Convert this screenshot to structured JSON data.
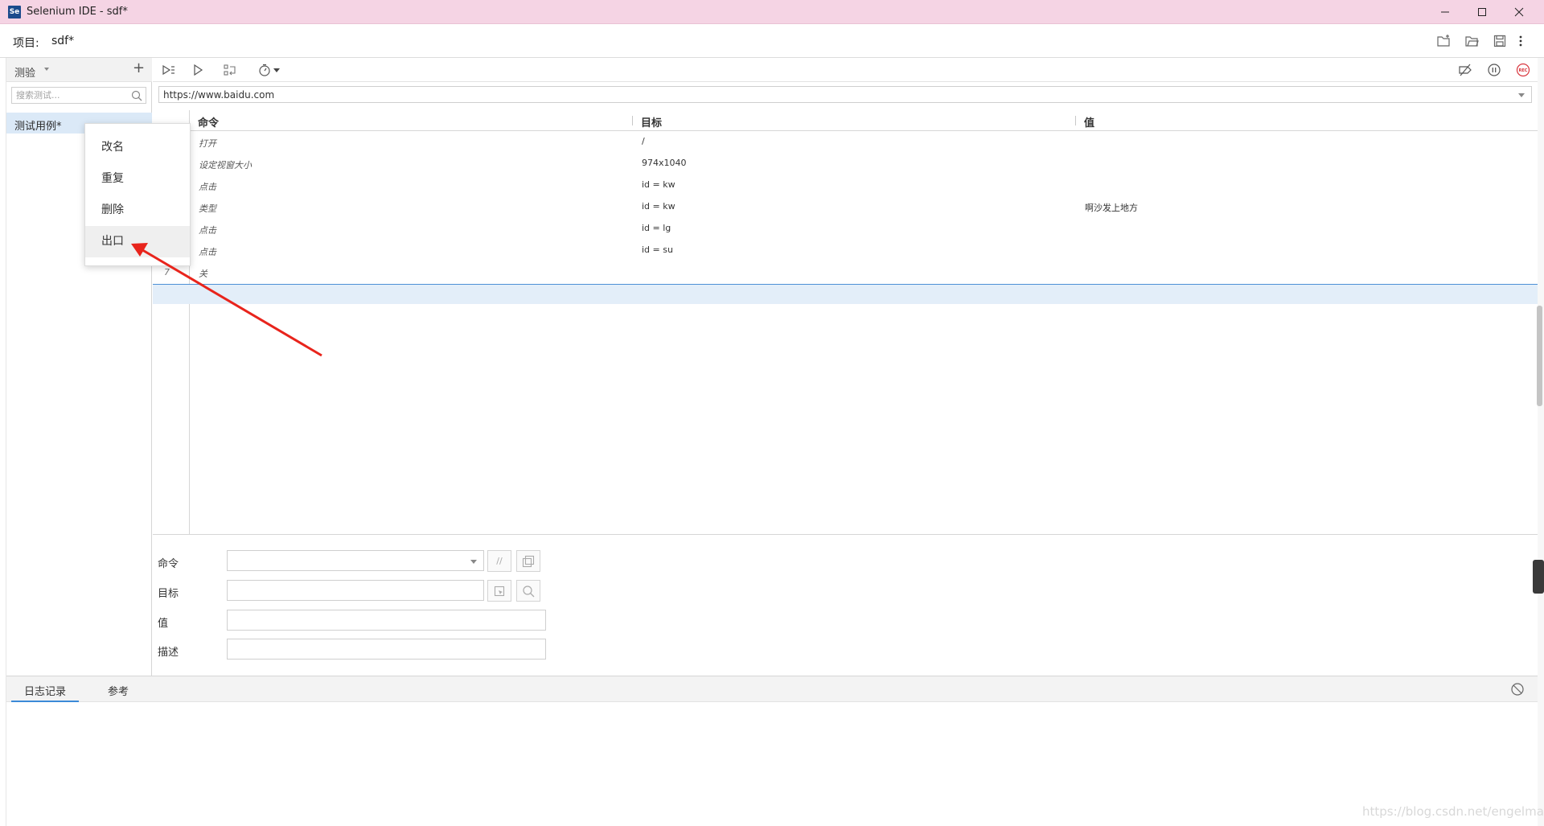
{
  "window": {
    "logo": "Se",
    "title": "Selenium IDE - sdf*"
  },
  "project": {
    "label": "项目:",
    "name": "sdf*"
  },
  "sidebar": {
    "dropdown_label": "测验",
    "add_label": "+",
    "search_placeholder": "搜索测试...",
    "items": [
      {
        "label": "测试用例*"
      }
    ]
  },
  "context_menu": {
    "items": [
      {
        "label": "改名"
      },
      {
        "label": "重复"
      },
      {
        "label": "删除"
      },
      {
        "label": "出口"
      }
    ]
  },
  "url_bar": {
    "value": "https://www.baidu.com"
  },
  "table": {
    "headers": {
      "command": "命令",
      "target": "目标",
      "value": "值"
    },
    "rows": [
      {
        "num": "",
        "command": "打开",
        "target": "/",
        "value": ""
      },
      {
        "num": "",
        "command": "设定视窗大小",
        "target": "974x1040",
        "value": ""
      },
      {
        "num": "",
        "command": "点击",
        "target": "id = kw",
        "value": ""
      },
      {
        "num": "",
        "command": "类型",
        "target": "id = kw",
        "value": "啊沙发上地方"
      },
      {
        "num": "",
        "command": "点击",
        "target": "id = lg",
        "value": ""
      },
      {
        "num": "",
        "command": "点击",
        "target": "id = su",
        "value": ""
      },
      {
        "num": "7",
        "command": "关",
        "target": "",
        "value": ""
      }
    ]
  },
  "editor": {
    "command_label": "命令",
    "target_label": "目标",
    "value_label": "值",
    "description_label": "描述",
    "comment_button": "//"
  },
  "log_panel": {
    "tabs": [
      {
        "label": "日志记录"
      },
      {
        "label": "参考"
      }
    ]
  },
  "watermark": "https://blog.csdn.net/engelmag",
  "colors": {
    "titlebar": "#f5d4e4",
    "selection": "#dbe9f7",
    "record": "#d9363e",
    "accent": "#3b8ad8",
    "arrow": "#e8241c"
  }
}
